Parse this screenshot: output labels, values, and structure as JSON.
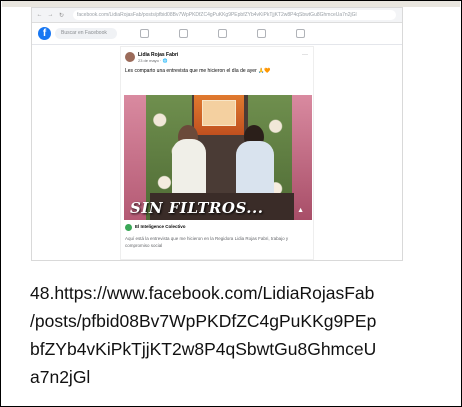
{
  "browser": {
    "url": "facebook.com/LidiaRojasFab/posts/pfbid08Bv7WpPKDfZC4gPuKKg9PEpbfZYb4vKiPkTjjKT2w8P4qSbwtGu8GhmceUa7n2jGl",
    "back_icon": "back-arrow-icon",
    "forward_icon": "forward-arrow-icon",
    "reload_icon": "reload-icon"
  },
  "facebook": {
    "logo_letter": "f",
    "search_placeholder": "Buscar en Facebook"
  },
  "post": {
    "author": "Lidia Rojas Fabri",
    "meta": "23 de mayo · 🌐",
    "text": "Les comparto una entrevista que me hicieron el día de ayer 🙏🧡",
    "video_caption": "SIN FILTROS...",
    "page_name": "El Inteligence Colectivo",
    "footer": "Aquí está la entrevista que me hicieron en la Regidora Lidia Rojas Fabri, trabajo y compromiso social"
  },
  "caption_lines": [
    "48.https://www.facebook.com/LidiaRojasFab",
    "/posts/pfbid08Bv7WpPKDfZC4gPuKKg9PEp",
    "bfZYb4vKiPkTjjKT2w8P4qSbwtGu8GhmceU",
    "a7n2jGl"
  ],
  "colors": {
    "facebook_blue": "#1877f2",
    "curtain_pink": "#d98aa0"
  }
}
